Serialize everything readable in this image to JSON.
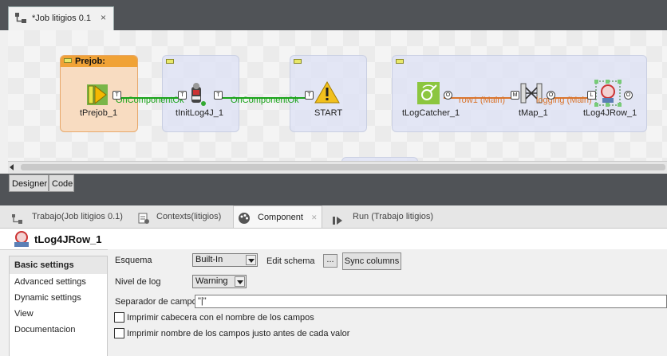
{
  "editor": {
    "tab_title": "*Job litigios 0.1",
    "close": "×"
  },
  "canvas": {
    "subjob_label": "Prejob:",
    "components": {
      "prejob": "tPrejob_1",
      "initlog": "tInitLog4J_1",
      "start": "START",
      "logcatcher": "tLogCatcher_1",
      "map": "tMap_1",
      "log4jrow": "tLog4JRow_1"
    },
    "connections": {
      "oncomp1": "OnComponentOk",
      "oncomp2": "OnComponentOk",
      "row1": "row1 (Main)",
      "logging": "logging (Main)"
    },
    "ports": {
      "t": "T",
      "o": "O",
      "m": "M",
      "l": "L"
    }
  },
  "designer_tabs": {
    "designer": "Designer",
    "code": "Code"
  },
  "view_tabs": {
    "trabajo": "Trabajo(Job litigios 0.1)",
    "contexts": "Contexts(litigios)",
    "component": "Component",
    "component_close": "✕",
    "run": "Run (Trabajo litigios)"
  },
  "component": {
    "title": "tLog4JRow_1",
    "icon_text": "LOG4J"
  },
  "settings_list": {
    "basic": "Basic settings",
    "advanced": "Advanced settings",
    "dynamic": "Dynamic settings",
    "view": "View",
    "doc": "Documentacion"
  },
  "form": {
    "esquema_label": "Esquema",
    "esquema_value": "Built-In",
    "edit_schema_label": "Edit schema",
    "edit_schema_button": "...",
    "sync_columns": "Sync columns",
    "nivel_label": "Nivel de log",
    "nivel_value": "Warning",
    "separador_label": "Separador de campo",
    "separador_value": "\"|\"",
    "chk1_label": "Imprimir cabecera con el nombre de los campos",
    "chk2_label": "Imprimir nombre de los campos justo antes de cada valor"
  },
  "colors": {
    "ok_link": "#1aa31a",
    "main_link": "#d9752e",
    "dark_bar": "#505357",
    "prejob_bg": "#f8dcc1",
    "prejob_head": "#f0a236"
  }
}
